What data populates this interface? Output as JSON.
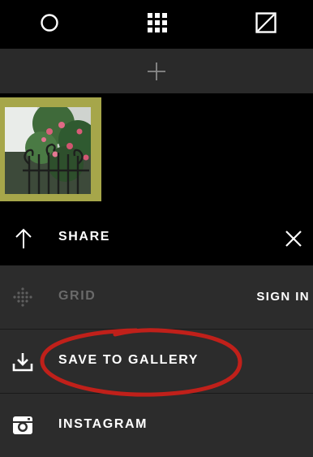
{
  "toolbar": {
    "left_icon": "circle-icon",
    "center_icon": "grid-icon",
    "right_icon": "edit-square-icon"
  },
  "add_bar": {
    "icon": "plus-icon"
  },
  "share": {
    "title": "SHARE",
    "back_icon": "arrow-up-icon",
    "close_icon": "close-icon"
  },
  "options": {
    "grid": {
      "label": "GRID",
      "icon": "grid-dots-icon",
      "action": "SIGN IN"
    },
    "save": {
      "label": "SAVE TO GALLERY",
      "icon": "download-icon"
    },
    "instagram": {
      "label": "INSTAGRAM",
      "icon": "instagram-icon"
    }
  },
  "colors": {
    "thumb_border": "#a6a64a",
    "annotation": "#c0201a",
    "row_bg": "#2c2c2c",
    "muted_text": "#6a6a6a"
  }
}
